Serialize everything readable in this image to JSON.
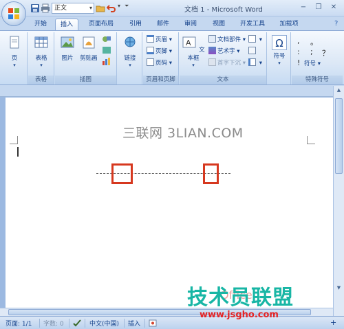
{
  "titlebar": {
    "doc_title": "文档 1 - Microsoft Word",
    "style_value": "正文",
    "minimize": "−",
    "maximize": "❐",
    "close": "✕"
  },
  "tabs": [
    "开始",
    "插入",
    "页面布局",
    "引用",
    "邮件",
    "审阅",
    "视图",
    "开发工具",
    "加载项"
  ],
  "active_tab": "插入",
  "ribbon": {
    "pages_group": {
      "label": "",
      "page_btn": "页"
    },
    "tables_group": {
      "label": "表格",
      "table_btn": "表格"
    },
    "illustrations_group": {
      "label": "插图",
      "picture_btn": "图片",
      "clipart_btn": "剪贴画"
    },
    "links_group": {
      "label": "",
      "link_btn": "链接"
    },
    "header_group": {
      "label": "页眉和页脚",
      "header_btn": "页眉",
      "footer_btn": "页脚",
      "pagenum_btn": "页码"
    },
    "text_group": {
      "label": "文本",
      "textbox_btn": "文本框",
      "docparts_btn": "文档部件",
      "wordart_btn": "艺术字",
      "dropcap_btn": "首字下沉"
    },
    "symbols_group": {
      "label": "",
      "symbol_btn": "符号"
    },
    "special_group": {
      "label": "特殊符号",
      "chars": [
        ",",
        "。",
        ":",
        ";",
        "？",
        "!"
      ],
      "symbol_btn": "符号"
    }
  },
  "document": {
    "watermark_text": "三联网 3LIAN.COM",
    "logo_text": "技术员联盟",
    "logo_url": "www.jsgho.com",
    "office_text": "Office"
  },
  "statusbar": {
    "page": "页面: 1/1",
    "words": "字数: 0",
    "language": "中文(中国)",
    "insert_mode": "插入"
  },
  "colors": {
    "accent": "#15428b",
    "highlight_box": "#d6381f",
    "logo_teal": "#18b6a5",
    "logo_red": "#e52424"
  }
}
